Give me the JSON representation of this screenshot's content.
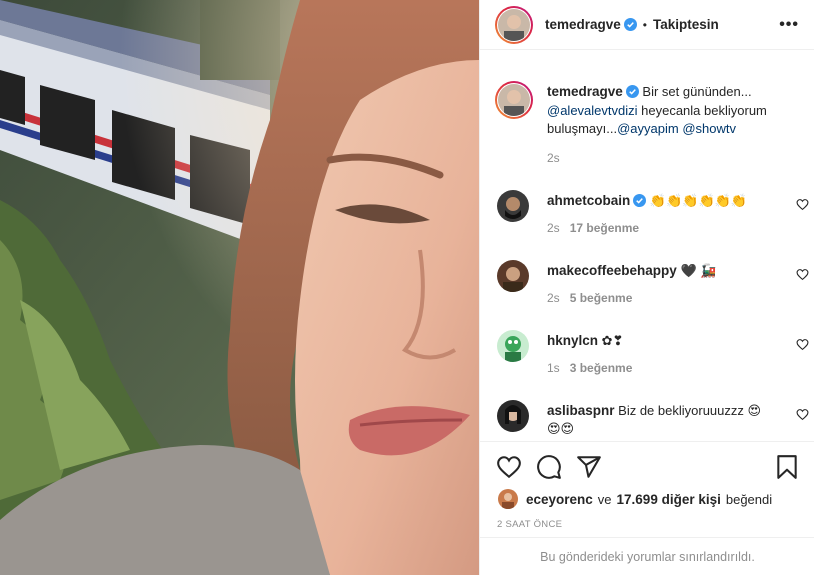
{
  "header": {
    "username": "temedragve",
    "separator": "•",
    "follow_status": "Takiptesin",
    "more_glyph": "•••"
  },
  "caption": {
    "username": "temedragve",
    "text": "Bir set gününden...",
    "mention1": "@alevalevtvdizi",
    "text2": "heyecanla bekliyorum buluşmayı...",
    "mention2": "@ayyapim",
    "mention3": "@showtv",
    "time": "2s"
  },
  "comments": [
    {
      "username": "ahmetcobain",
      "verified": true,
      "text": "👏👏👏👏👏👏",
      "time": "2s",
      "likes": "17 beğenme"
    },
    {
      "username": "makecoffeebehappy",
      "verified": false,
      "text": "🖤 🚂",
      "time": "2s",
      "likes": "5 beğenme"
    },
    {
      "username": "hknylcn",
      "verified": false,
      "text": "✿❣",
      "time": "1s",
      "likes": "3 beğenme"
    },
    {
      "username": "aslibaspnr",
      "verified": false,
      "text": "Biz de bekliyoruuuzzz 😍😍😍",
      "time": "",
      "likes": ""
    }
  ],
  "likes": {
    "username": "eceyorenc",
    "conj": "ve",
    "others": "17.699 diğer kişi",
    "suffix": "beğendi"
  },
  "posted_ago": "2 SAAT ÖNCE",
  "comments_limited": "Bu gönderideki yorumlar sınırlandırıldı.",
  "icons": [
    "heart-icon",
    "comment-icon",
    "share-icon",
    "bookmark-icon",
    "verified-badge-icon",
    "more-options-icon"
  ],
  "colors": {
    "verified": "#3897f0",
    "link": "#00376b",
    "muted": "#8e8e8e",
    "border": "#efefef"
  }
}
